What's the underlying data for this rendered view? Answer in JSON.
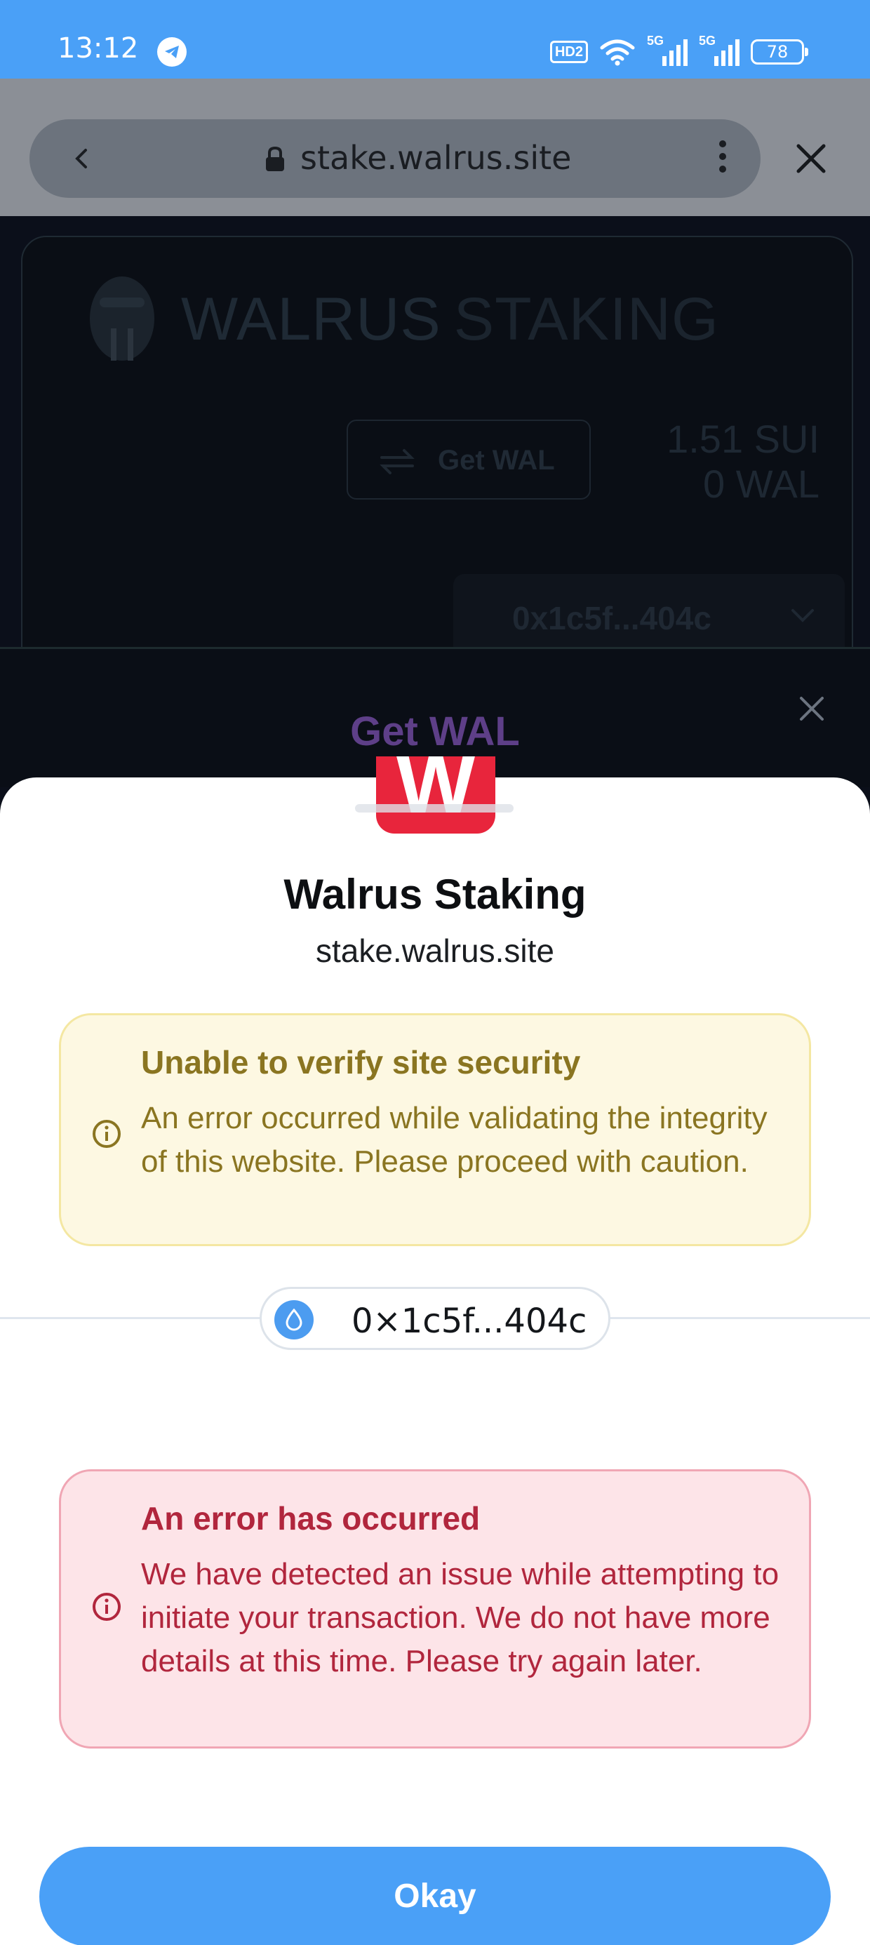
{
  "status_bar": {
    "time": "13:12",
    "hd_label": "HD2",
    "net1": "5G",
    "net2": "5G",
    "battery": "78"
  },
  "browser": {
    "url": "stake.walrus.site"
  },
  "background_page": {
    "title_part1": "WALRUS",
    "title_part2": "STAKING",
    "get_wal_label": "Get WAL",
    "sui_balance": "1.51 SUI",
    "wal_balance": "0 WAL",
    "wallet_address": "0x1c5f...404c"
  },
  "get_wal_modal": {
    "title": "Get WAL"
  },
  "sheet": {
    "logo_letter": "W",
    "dapp_name": "Walrus Staking",
    "dapp_url": "stake.walrus.site",
    "warning": {
      "title": "Unable to verify site security",
      "body": "An error occurred while validating the integrity of this website. Please proceed with caution."
    },
    "address": "0×1c5f...404c",
    "error": {
      "title": "An error has occurred",
      "body": "We have detected an issue while attempting to initiate your transaction. We do not have more details at this time. Please try again later."
    },
    "okay_label": "Okay"
  },
  "colors": {
    "accent": "#4aa0f7",
    "warning_text": "#8a7521",
    "warning_bg": "#fdf8e2",
    "error_text": "#b1263d",
    "error_bg": "#fde4e8",
    "logo_red": "#e8253c"
  }
}
